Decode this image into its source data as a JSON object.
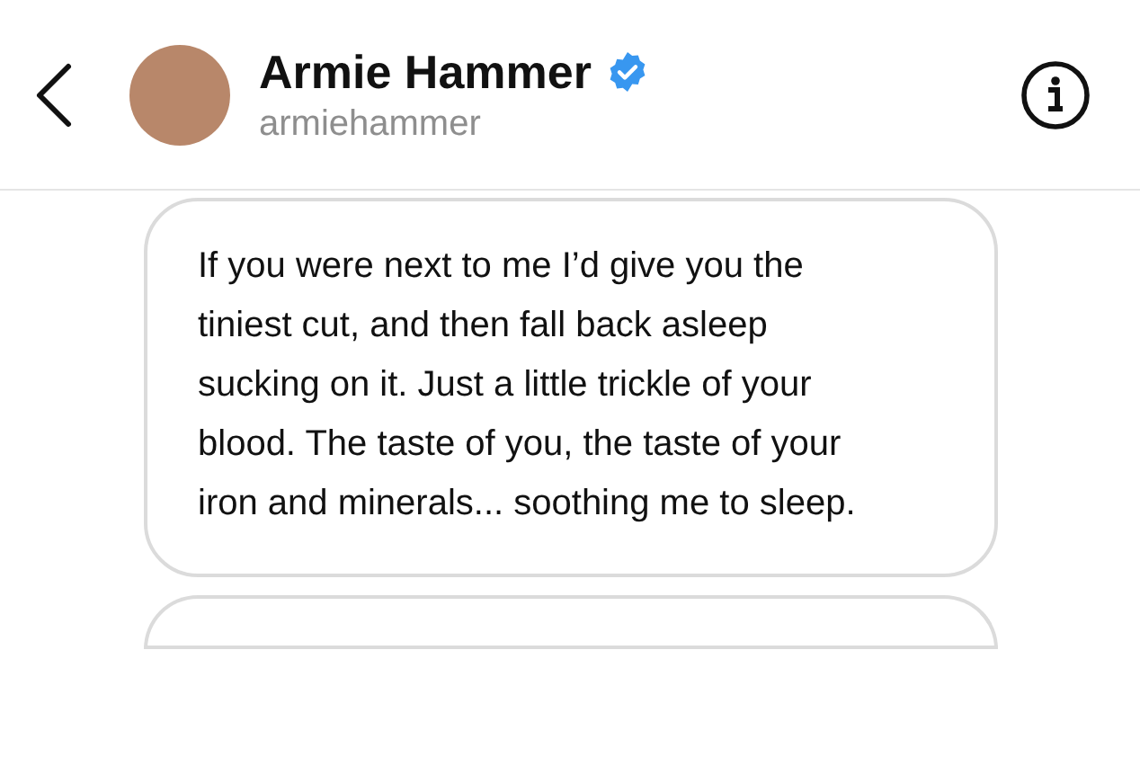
{
  "header": {
    "name": "Armie Hammer",
    "username": "armiehammer",
    "verified": true
  },
  "messages": [
    {
      "text": "If you were next to me I’d give you the tiniest cut, and then fall back asleep sucking on it. Just a little trickle of your blood. The taste of you, the taste of your iron and minerals... soothing me to sleep."
    }
  ]
}
